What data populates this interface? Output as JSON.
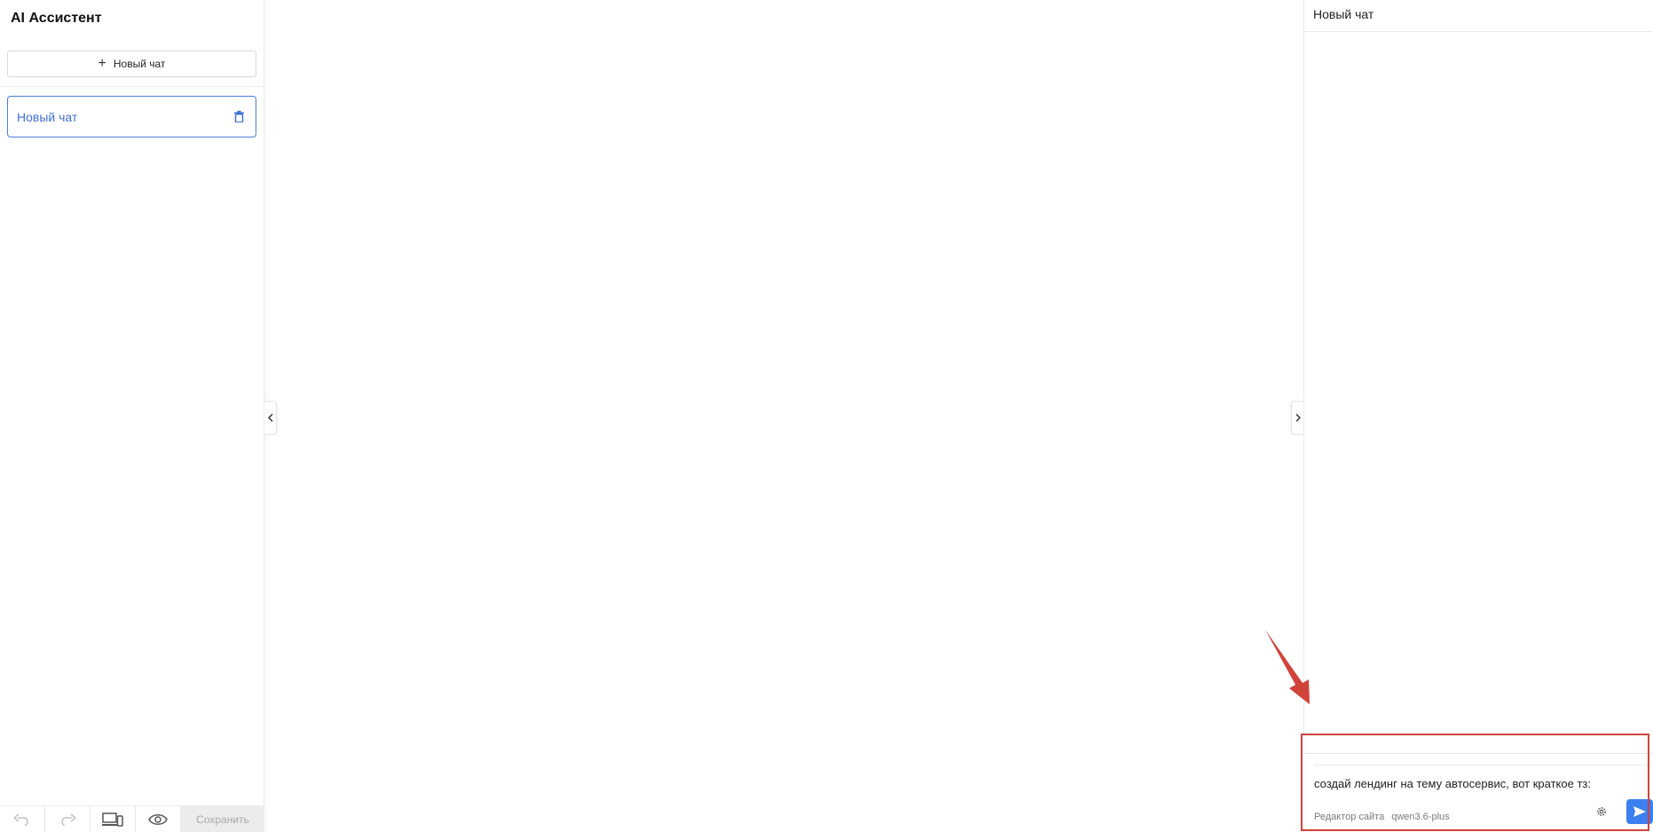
{
  "sidebar": {
    "title": "AI Ассистент",
    "new_chat_label": "Новый чат",
    "chats": [
      {
        "label": "Новый чат",
        "active": true
      }
    ]
  },
  "toolbar": {
    "undo_icon": "undo-icon",
    "redo_icon": "redo-icon",
    "devices_icon": "devices-icon",
    "preview_icon": "eye-icon",
    "save_label": "Сохранить"
  },
  "chat": {
    "header_title": "Новый чат",
    "input_value": "создай лендинг на тему автосервис, вот краткое тз:",
    "mode_label": "Редактор сайта",
    "model_label": "qwen3.6-plus"
  },
  "colors": {
    "accent": "#3b7ff0",
    "active_border": "#4a7ee0",
    "annotation": "#d0433b"
  }
}
